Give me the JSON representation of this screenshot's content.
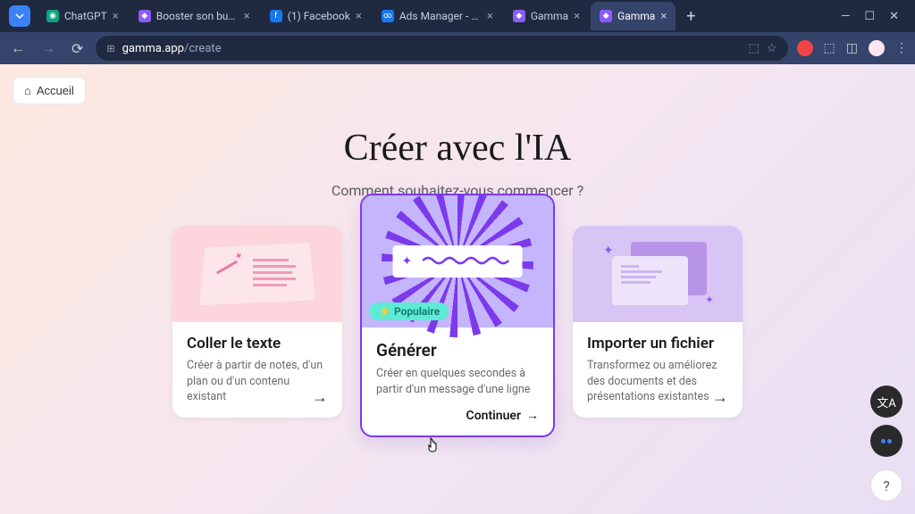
{
  "browser": {
    "tabs": [
      {
        "title": "ChatGPT",
        "favicon_bg": "#10a37f"
      },
      {
        "title": "Booster son business",
        "favicon_bg": "#8b5cf6"
      },
      {
        "title": "(1) Facebook",
        "favicon_bg": "#1877f2"
      },
      {
        "title": "Ads Manager - Mana",
        "favicon_bg": "#1877f2"
      },
      {
        "title": "Gamma",
        "favicon_bg": "#8b5cf6"
      },
      {
        "title": "Gamma",
        "favicon_bg": "#8b5cf6",
        "active": true
      }
    ],
    "url_domain": "gamma.app",
    "url_path": "/create"
  },
  "page": {
    "home_label": "Accueil",
    "title": "Créer avec l'IA",
    "subtitle": "Comment souhaitez-vous commencer ?",
    "cards": [
      {
        "title": "Coller le texte",
        "desc": "Créer à partir de notes, d'un plan ou d'un contenu existant"
      },
      {
        "title": "Générer",
        "desc": "Créer en quelques secondes à partir d'un message d'une ligne",
        "badge": "Populaire",
        "continue": "Continuer"
      },
      {
        "title": "Importer un fichier",
        "desc": "Transformez ou améliorez des documents et des présentations existantes"
      }
    ]
  }
}
